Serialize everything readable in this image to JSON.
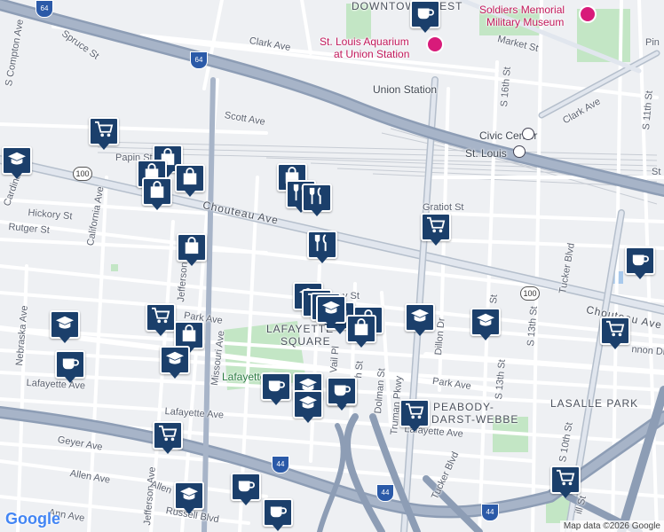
{
  "streets": {
    "s_compton": "S Compton Ave",
    "spruce": "Spruce St",
    "clark_w": "Clark Ave",
    "clark_e": "Clark Ave",
    "scott": "Scott Ave",
    "papin": "Papin St",
    "hickory": "Hickory St",
    "rutger": "Rutger St",
    "cardinal": "Cardinal",
    "california": "California Ave",
    "chouteau_w": "Chouteau Ave",
    "chouteau_e": "Chouteau Ave",
    "jefferson_n": "Jefferson Ave",
    "jefferson_s": "Jefferson Ave",
    "nebraska": "Nebraska Ave",
    "park_w": "Park Ave",
    "park_e": "Park Ave",
    "lafayette_w": "Lafayette Ave",
    "lafayette_m": "Lafayette Ave",
    "lafayette_e": "Lafayette Ave",
    "missouri": "Missouri Ave",
    "geyer": "Geyer Ave",
    "allen_w": "Allen Ave",
    "allen_m": "Allen",
    "ann": "Ann Ave",
    "russell": "Russell Blvd",
    "market": "Market St",
    "gratiot": "Gratiot St",
    "tucker_n": "Tucker Blvd",
    "tucker_s": "Tucker Blvd",
    "truman": "Truman Pkwy",
    "dolman": "Dolman St",
    "dillon": "Dillon Dr",
    "s16th": "S 16th St",
    "s13th": "S 13th St",
    "s13th_b": "S 13th St",
    "s11th": "S 11th St",
    "s10th": "S 10th St",
    "s14th": "St",
    "vail": "Vail Pl",
    "hst": "h St",
    "yst": "y St",
    "nnon": "nnon Dr",
    "pin": "Pin",
    "st_edge": "St",
    "ill": "ill St"
  },
  "places": {
    "downtown_west": "DOWNTOWN WEST",
    "lafayette_square_1": "LAFAYETTE",
    "lafayette_square_2": "SQUARE",
    "lasalle_park": "LASALLE PARK",
    "peabody_1": "PEABODY-",
    "peabody_2": "DARST-WEBBE",
    "lafayette_park": "Lafayette Park"
  },
  "pois": {
    "soldiers_1": "Soldiers Memorial",
    "soldiers_2": "Military Museum",
    "aquarium_1": "St. Louis Aquarium",
    "aquarium_2": "at Union Station",
    "union_station": "Union Station",
    "civic_center": "Civic Center",
    "st_louis": "St. Louis"
  },
  "shields": {
    "i64_a": "64",
    "i64_b": "64",
    "i44_a": "44",
    "i44_b": "44",
    "i44_c": "44",
    "us100_a": "100",
    "us100_b": "100"
  },
  "attribution": {
    "google": "Google",
    "map_data": "Map data ©2026 Google"
  },
  "colors": {
    "highway": "#8d9db5",
    "marker": "#1b3f6b",
    "park": "#c3e6c5",
    "aquarium_pin": "#d81b7a"
  },
  "markers": [
    {
      "icon": "shopping-cart-icon"
    },
    {
      "icon": "graduation-cap-icon"
    },
    {
      "icon": "shopping-bag-icon"
    },
    {
      "icon": "shopping-bag-icon"
    },
    {
      "icon": "shopping-bag-icon"
    },
    {
      "icon": "shopping-bag-icon"
    },
    {
      "icon": "shopping-bag-icon"
    },
    {
      "icon": "utensils-icon"
    },
    {
      "icon": "utensils-icon"
    },
    {
      "icon": "utensils-icon"
    },
    {
      "icon": "shopping-bag-icon"
    },
    {
      "icon": "shopping-cart-icon"
    },
    {
      "icon": "coffee-cup-icon"
    },
    {
      "icon": "coffee-cup-icon"
    },
    {
      "icon": "graduation-cap-icon"
    },
    {
      "icon": "shopping-cart-icon"
    },
    {
      "icon": "shopping-bag-icon"
    },
    {
      "icon": "coffee-cup-icon"
    },
    {
      "icon": "graduation-cap-icon"
    },
    {
      "icon": "shopping-cart-icon"
    },
    {
      "icon": "shopping-cart-icon"
    },
    {
      "icon": "graduation-cap-icon"
    },
    {
      "icon": "graduation-cap-icon"
    },
    {
      "icon": "shopping-bag-icon"
    },
    {
      "icon": "shopping-bag-icon"
    },
    {
      "icon": "shopping-bag-icon"
    },
    {
      "icon": "graduation-cap-icon"
    },
    {
      "icon": "graduation-cap-icon"
    },
    {
      "icon": "shopping-cart-icon"
    },
    {
      "icon": "shopping-cart-icon"
    },
    {
      "icon": "coffee-cup-icon"
    },
    {
      "icon": "coffee-cup-icon"
    },
    {
      "icon": "graduation-cap-icon"
    },
    {
      "icon": "coffee-cup-icon"
    },
    {
      "icon": "graduation-cap-icon"
    },
    {
      "icon": "shopping-cart-icon"
    },
    {
      "icon": "graduation-cap-icon"
    },
    {
      "icon": "graduation-cap-icon"
    },
    {
      "icon": "coffee-cup-icon"
    },
    {
      "icon": "coffee-cup-icon"
    }
  ]
}
